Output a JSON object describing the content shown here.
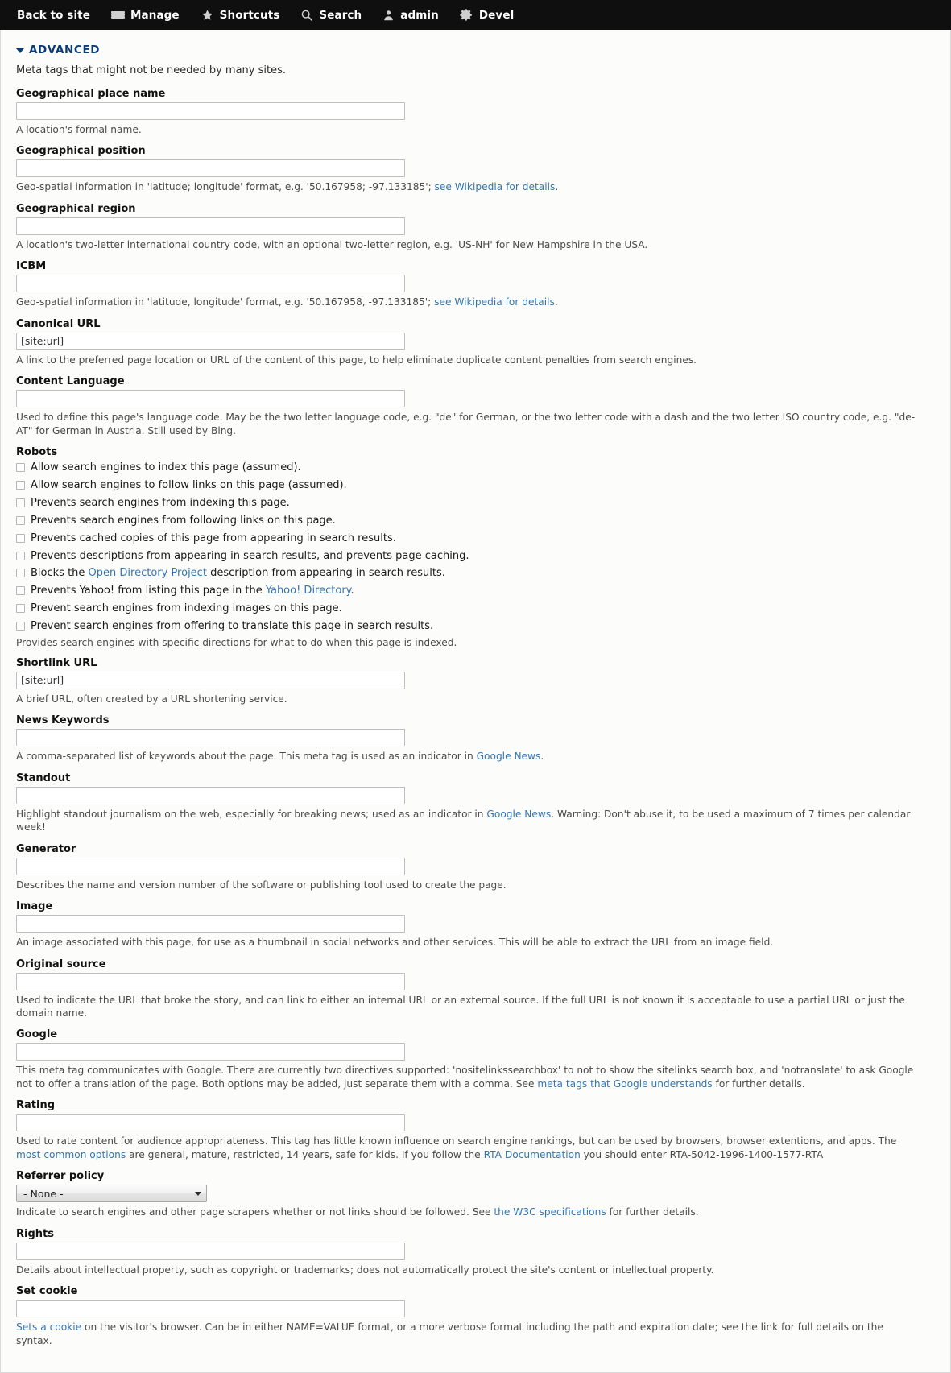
{
  "toolbar": {
    "items": [
      {
        "label": "Back to site",
        "icon": "none"
      },
      {
        "label": "Manage",
        "icon": "hamburger-icon"
      },
      {
        "label": "Shortcuts",
        "icon": "star-icon"
      },
      {
        "label": "Search",
        "icon": "search-icon"
      },
      {
        "label": "admin",
        "icon": "user-icon"
      },
      {
        "label": "Devel",
        "icon": "gear-icon"
      }
    ]
  },
  "fieldset": {
    "legend": "ADVANCED",
    "intro": "Meta tags that might not be needed by many sites."
  },
  "fields": {
    "geo_placename": {
      "label": "Geographical place name",
      "value": "",
      "desc": "A location's formal name."
    },
    "geo_position": {
      "label": "Geographical position",
      "value": "",
      "desc_pre": "Geo-spatial information in 'latitude; longitude' format, e.g. '50.167958; -97.133185'; ",
      "desc_link": "see Wikipedia for details",
      "desc_post": "."
    },
    "geo_region": {
      "label": "Geographical region",
      "value": "",
      "desc": "A location's two-letter international country code, with an optional two-letter region, e.g. 'US-NH' for New Hampshire in the USA."
    },
    "icbm": {
      "label": "ICBM",
      "value": "",
      "desc_pre": "Geo-spatial information in 'latitude, longitude' format, e.g. '50.167958, -97.133185'; ",
      "desc_link": "see Wikipedia for details",
      "desc_post": "."
    },
    "canonical_url": {
      "label": "Canonical URL",
      "value": "[site:url]",
      "desc": "A link to the preferred page location or URL of the content of this page, to help eliminate duplicate content penalties from search engines."
    },
    "content_language": {
      "label": "Content Language",
      "value": "",
      "desc": "Used to define this page's language code. May be the two letter language code, e.g. \"de\" for German, or the two letter code with a dash and the two letter ISO country code, e.g. \"de-AT\" for German in Austria. Still used by Bing."
    },
    "robots": {
      "label": "Robots",
      "options": [
        {
          "text": "Allow search engines to index this page (assumed).",
          "checked": false
        },
        {
          "text": "Allow search engines to follow links on this page (assumed).",
          "checked": false
        },
        {
          "text": "Prevents search engines from indexing this page.",
          "checked": false
        },
        {
          "text": "Prevents search engines from following links on this page.",
          "checked": false
        },
        {
          "text": "Prevents cached copies of this page from appearing in search results.",
          "checked": false
        },
        {
          "text": "Prevents descriptions from appearing in search results, and prevents page caching.",
          "checked": false
        },
        {
          "text_pre": "Blocks the ",
          "link": "Open Directory Project",
          "text_post": " description from appearing in search results.",
          "checked": false
        },
        {
          "text_pre": "Prevents Yahoo! from listing this page in the ",
          "link": "Yahoo! Directory",
          "text_post": ".",
          "checked": false
        },
        {
          "text": "Prevent search engines from indexing images on this page.",
          "checked": false
        },
        {
          "text": "Prevent search engines from offering to translate this page in search results.",
          "checked": false
        }
      ],
      "desc": "Provides search engines with specific directions for what to do when this page is indexed."
    },
    "shortlink_url": {
      "label": "Shortlink URL",
      "value": "[site:url]",
      "desc": "A brief URL, often created by a URL shortening service."
    },
    "news_keywords": {
      "label": "News Keywords",
      "value": "",
      "desc_pre": "A comma-separated list of keywords about the page. This meta tag is used as an indicator in ",
      "desc_link": "Google News",
      "desc_post": "."
    },
    "standout": {
      "label": "Standout",
      "value": "",
      "desc_pre": "Highlight standout journalism on the web, especially for breaking news; used as an indicator in ",
      "desc_link": "Google News",
      "desc_post": ". Warning: Don't abuse it, to be used a maximum of 7 times per calendar week!"
    },
    "generator": {
      "label": "Generator",
      "value": "",
      "desc": "Describes the name and version number of the software or publishing tool used to create the page."
    },
    "image": {
      "label": "Image",
      "value": "",
      "desc": "An image associated with this page, for use as a thumbnail in social networks and other services. This will be able to extract the URL from an image field."
    },
    "original_source": {
      "label": "Original source",
      "value": "",
      "desc": "Used to indicate the URL that broke the story, and can link to either an internal URL or an external source. If the full URL is not known it is acceptable to use a partial URL or just the domain name."
    },
    "google": {
      "label": "Google",
      "value": "",
      "desc_pre": "This meta tag communicates with Google. There are currently two directives supported: 'nositelinkssearchbox' to not to show the sitelinks search box, and 'notranslate' to ask Google not to offer a translation of the page. Both options may be added, just separate them with a comma. See ",
      "desc_link": "meta tags that Google understands",
      "desc_post": " for further details."
    },
    "rating": {
      "label": "Rating",
      "value": "",
      "desc_a": "Used to rate content for audience appropriateness. This tag has little known influence on search engine rankings, but can be used by browsers, browser extentions, and apps. The ",
      "desc_link1": "most common options",
      "desc_b": " are general, mature, restricted, 14 years, safe for kids. If you follow the ",
      "desc_link2": "RTA Documentation",
      "desc_c": " you should enter RTA-5042-1996-1400-1577-RTA"
    },
    "referrer_policy": {
      "label": "Referrer policy",
      "value": "- None -",
      "desc_pre": "Indicate to search engines and other page scrapers whether or not links should be followed. See ",
      "desc_link": "the W3C specifications",
      "desc_post": " for further details."
    },
    "rights": {
      "label": "Rights",
      "value": "",
      "desc": "Details about intellectual property, such as copyright or trademarks; does not automatically protect the site's content or intellectual property."
    },
    "set_cookie": {
      "label": "Set cookie",
      "value": "",
      "desc_link": "Sets a cookie",
      "desc_post": " on the visitor's browser. Can be in either NAME=VALUE format, or a more verbose format including the path and expiration date; see the link for full details on the syntax."
    }
  },
  "colors": {
    "toolbar_bg": "#0f0f0f",
    "legend": "#0c3c75",
    "link": "#3476b2",
    "panel_bg": "#fcfcfa"
  }
}
